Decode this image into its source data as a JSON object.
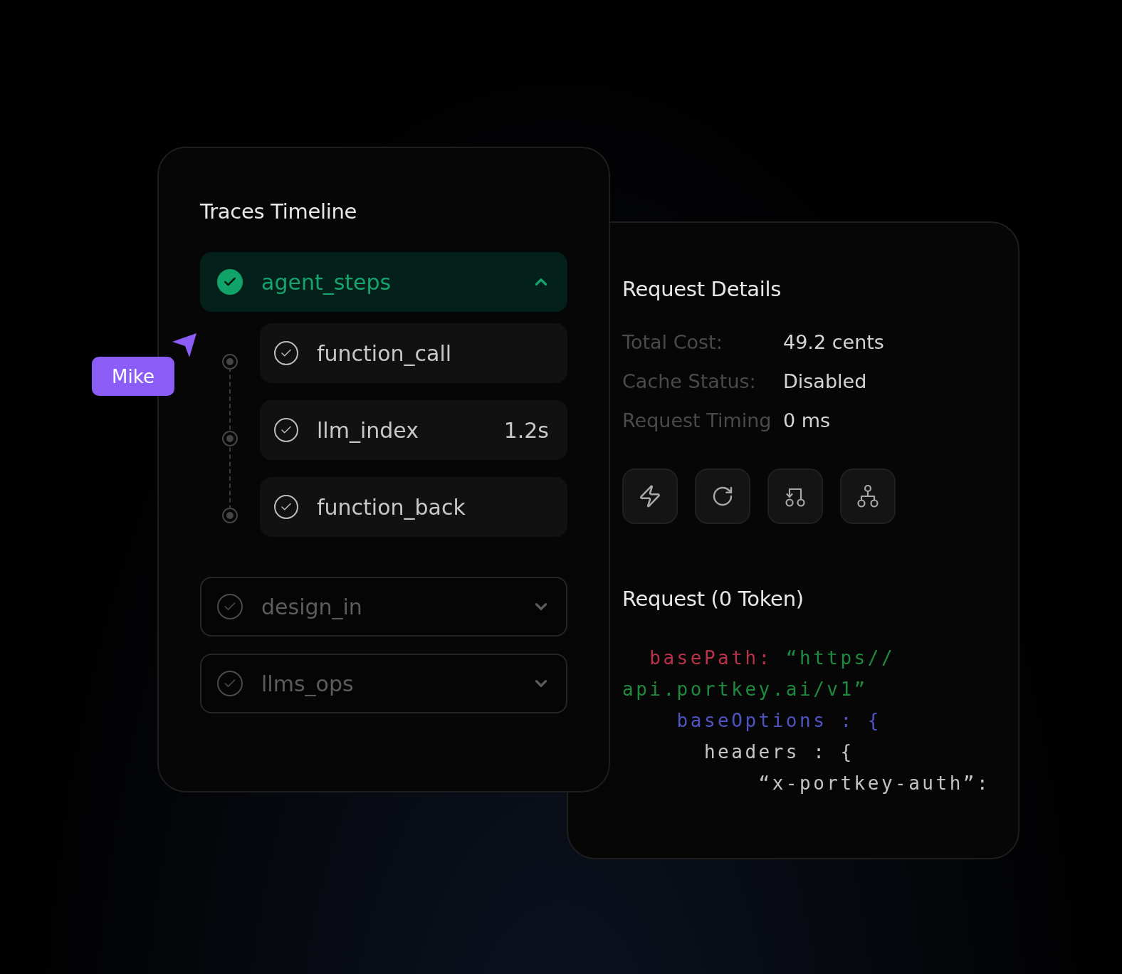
{
  "traces_panel": {
    "title": "Traces Timeline",
    "items": [
      {
        "name": "agent_steps",
        "expanded": true,
        "children": [
          {
            "name": "function_call"
          },
          {
            "name": "llm_index",
            "duration": "1.2s"
          },
          {
            "name": "function_back"
          }
        ]
      },
      {
        "name": "design_in",
        "expanded": false
      },
      {
        "name": "llms_ops",
        "expanded": false
      }
    ]
  },
  "cursor": {
    "label": "Mike"
  },
  "details_panel": {
    "title": "Request Details",
    "fields": [
      {
        "label": "Total Cost:",
        "value": "49.2 cents"
      },
      {
        "label": "Cache Status:",
        "value": "Disabled"
      },
      {
        "label": "Request Timing",
        "value": "0 ms"
      }
    ],
    "request_title": "Request (0 Token)",
    "code_lines": [
      [
        {
          "kind": "key",
          "text": "  basePath:"
        },
        {
          "kind": "string",
          "text": " “https//"
        }
      ],
      [
        {
          "kind": "string",
          "text": "api.portkey.ai/v1”"
        }
      ],
      [
        {
          "kind": "option",
          "text": "    baseOptions : {"
        }
      ],
      [
        {
          "kind": "plain",
          "text": "      headers : {"
        }
      ],
      [
        {
          "kind": "plain",
          "text": "          “x-portkey-auth”:"
        }
      ]
    ]
  }
}
